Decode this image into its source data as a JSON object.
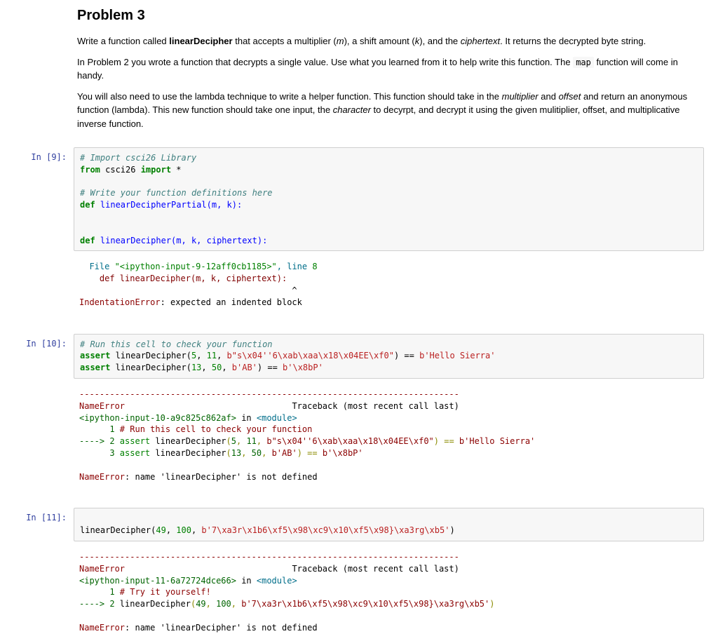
{
  "problem": {
    "title": "Problem 3",
    "p1_a": "Write a function called ",
    "p1_b": "linearDecipher",
    "p1_c": " that accepts a multiplier (",
    "p1_m": "m",
    "p1_d": "), a shift amount (",
    "p1_k": "k",
    "p1_e": "), and the ",
    "p1_ct": "ciphertext",
    "p1_f": ". It returns the decrypted byte string.",
    "p2_a": "In Problem 2 you wrote a function that decrypts a single value. Use what you learned from it to help write this function. The ",
    "p2_map": "map",
    "p2_b": " function will come in handy.",
    "p3_a": "You will also need to use the lambda technique to write a helper function. This function should take in the ",
    "p3_mult": "multiplier",
    "p3_b": " and ",
    "p3_off": "offset",
    "p3_c": " and return an anonymous function (lambda). This new function should take one input, the ",
    "p3_char": "character",
    "p3_d": " to decyrpt, and decrypt it using the given mulitiplier, offset, and multiplicative inverse function."
  },
  "cell9": {
    "prompt": "In [9]:",
    "l1": "# Import csci26 Library",
    "l2a": "from",
    "l2b": " csci26 ",
    "l2c": "import",
    "l2d": " *",
    "l4": "# Write your function definitions here",
    "l5a": "def",
    "l5b": " linearDecipherPartial(m, k):",
    "l8a": "def",
    "l8b": " linearDecipher(m, k, ciphertext):",
    "out": {
      "file_a": "  File ",
      "file_q": "\"<ipython-input-9-12aff0cb1185>\"",
      "file_c": ", line ",
      "file_n": "8",
      "defline": "    def linearDecipher(m, k, ciphertext):",
      "caret": "                                          ^",
      "err_name": "IndentationError",
      "err_msg": ": expected an indented block"
    }
  },
  "cell10": {
    "prompt": "In [10]:",
    "l1": "# Run this cell to check your function",
    "l2a": "assert",
    "l2b": " linearDecipher(",
    "l2c": "5",
    "l2d": ", ",
    "l2e": "11",
    "l2f": ", ",
    "l2g": "b\"s\\x04''6\\xab\\xaa\\x18\\x04EE\\xf0\"",
    "l2h": ") == ",
    "l2i": "b'Hello Sierra'",
    "l3a": "assert",
    "l3b": " linearDecipher(",
    "l3c": "13",
    "l3d": ", ",
    "l3e": "50",
    "l3f": ", ",
    "l3g": "b'AB'",
    "l3h": ") == ",
    "l3i": "b'\\x8bP'",
    "out": {
      "dash": "---------------------------------------------------------------------------",
      "err_name": "NameError",
      "tb": "                                 Traceback (most recent call last)",
      "mod_a": "<ipython-input-10-a9c825c862af>",
      "mod_b": " in ",
      "mod_c": "<module>",
      "ln1_a": "      1 ",
      "ln1_b": "# Run this cell to check your function",
      "ln2_a": "----> 2 ",
      "ln2_b": "assert",
      "ln2_c": " linearDecipher",
      "ln2_d": "(",
      "ln2_e": "5",
      "ln2_f": ", ",
      "ln2_g": "11",
      "ln2_h": ", ",
      "ln2_i": "b\"s\\x04''6\\xab\\xaa\\x18\\x04EE\\xf0\"",
      "ln2_j": ") == ",
      "ln2_k": "b'Hello Sierra'",
      "ln3_a": "      3 ",
      "ln3_b": "assert",
      "ln3_c": " linearDecipher",
      "ln3_d": "(",
      "ln3_e": "13",
      "ln3_f": ", ",
      "ln3_g": "50",
      "ln3_h": ", ",
      "ln3_i": "b'AB'",
      "ln3_j": ") == ",
      "ln3_k": "b'\\x8bP'",
      "final_a": "NameError",
      "final_b": ": name 'linearDecipher' is not defined"
    }
  },
  "cell11": {
    "prompt": "In [11]:",
    "l2a": "linearDecipher(",
    "l2b": "49",
    "l2c": ", ",
    "l2d": "100",
    "l2e": ", ",
    "l2f": "b'7\\xa3r\\x1b6\\xf5\\x98\\xc9\\x10\\xf5\\x98}\\xa3rg\\xb5'",
    "l2g": ")",
    "out": {
      "dash": "---------------------------------------------------------------------------",
      "err_name": "NameError",
      "tb": "                                 Traceback (most recent call last)",
      "mod_a": "<ipython-input-11-6a72724dce66>",
      "mod_b": " in ",
      "mod_c": "<module>",
      "ln1_a": "      1 ",
      "ln1_b": "# Try it yourself!",
      "ln2_a": "----> 2 ",
      "ln2_b": "linearDecipher",
      "ln2_c": "(",
      "ln2_d": "49",
      "ln2_e": ", ",
      "ln2_f": "100",
      "ln2_g": ", ",
      "ln2_h": "b'7\\xa3r\\x1b6\\xf5\\x98\\xc9\\x10\\xf5\\x98}\\xa3rg\\xb5'",
      "ln2_i": ")",
      "final_a": "NameError",
      "final_b": ": name 'linearDecipher' is not defined"
    }
  }
}
